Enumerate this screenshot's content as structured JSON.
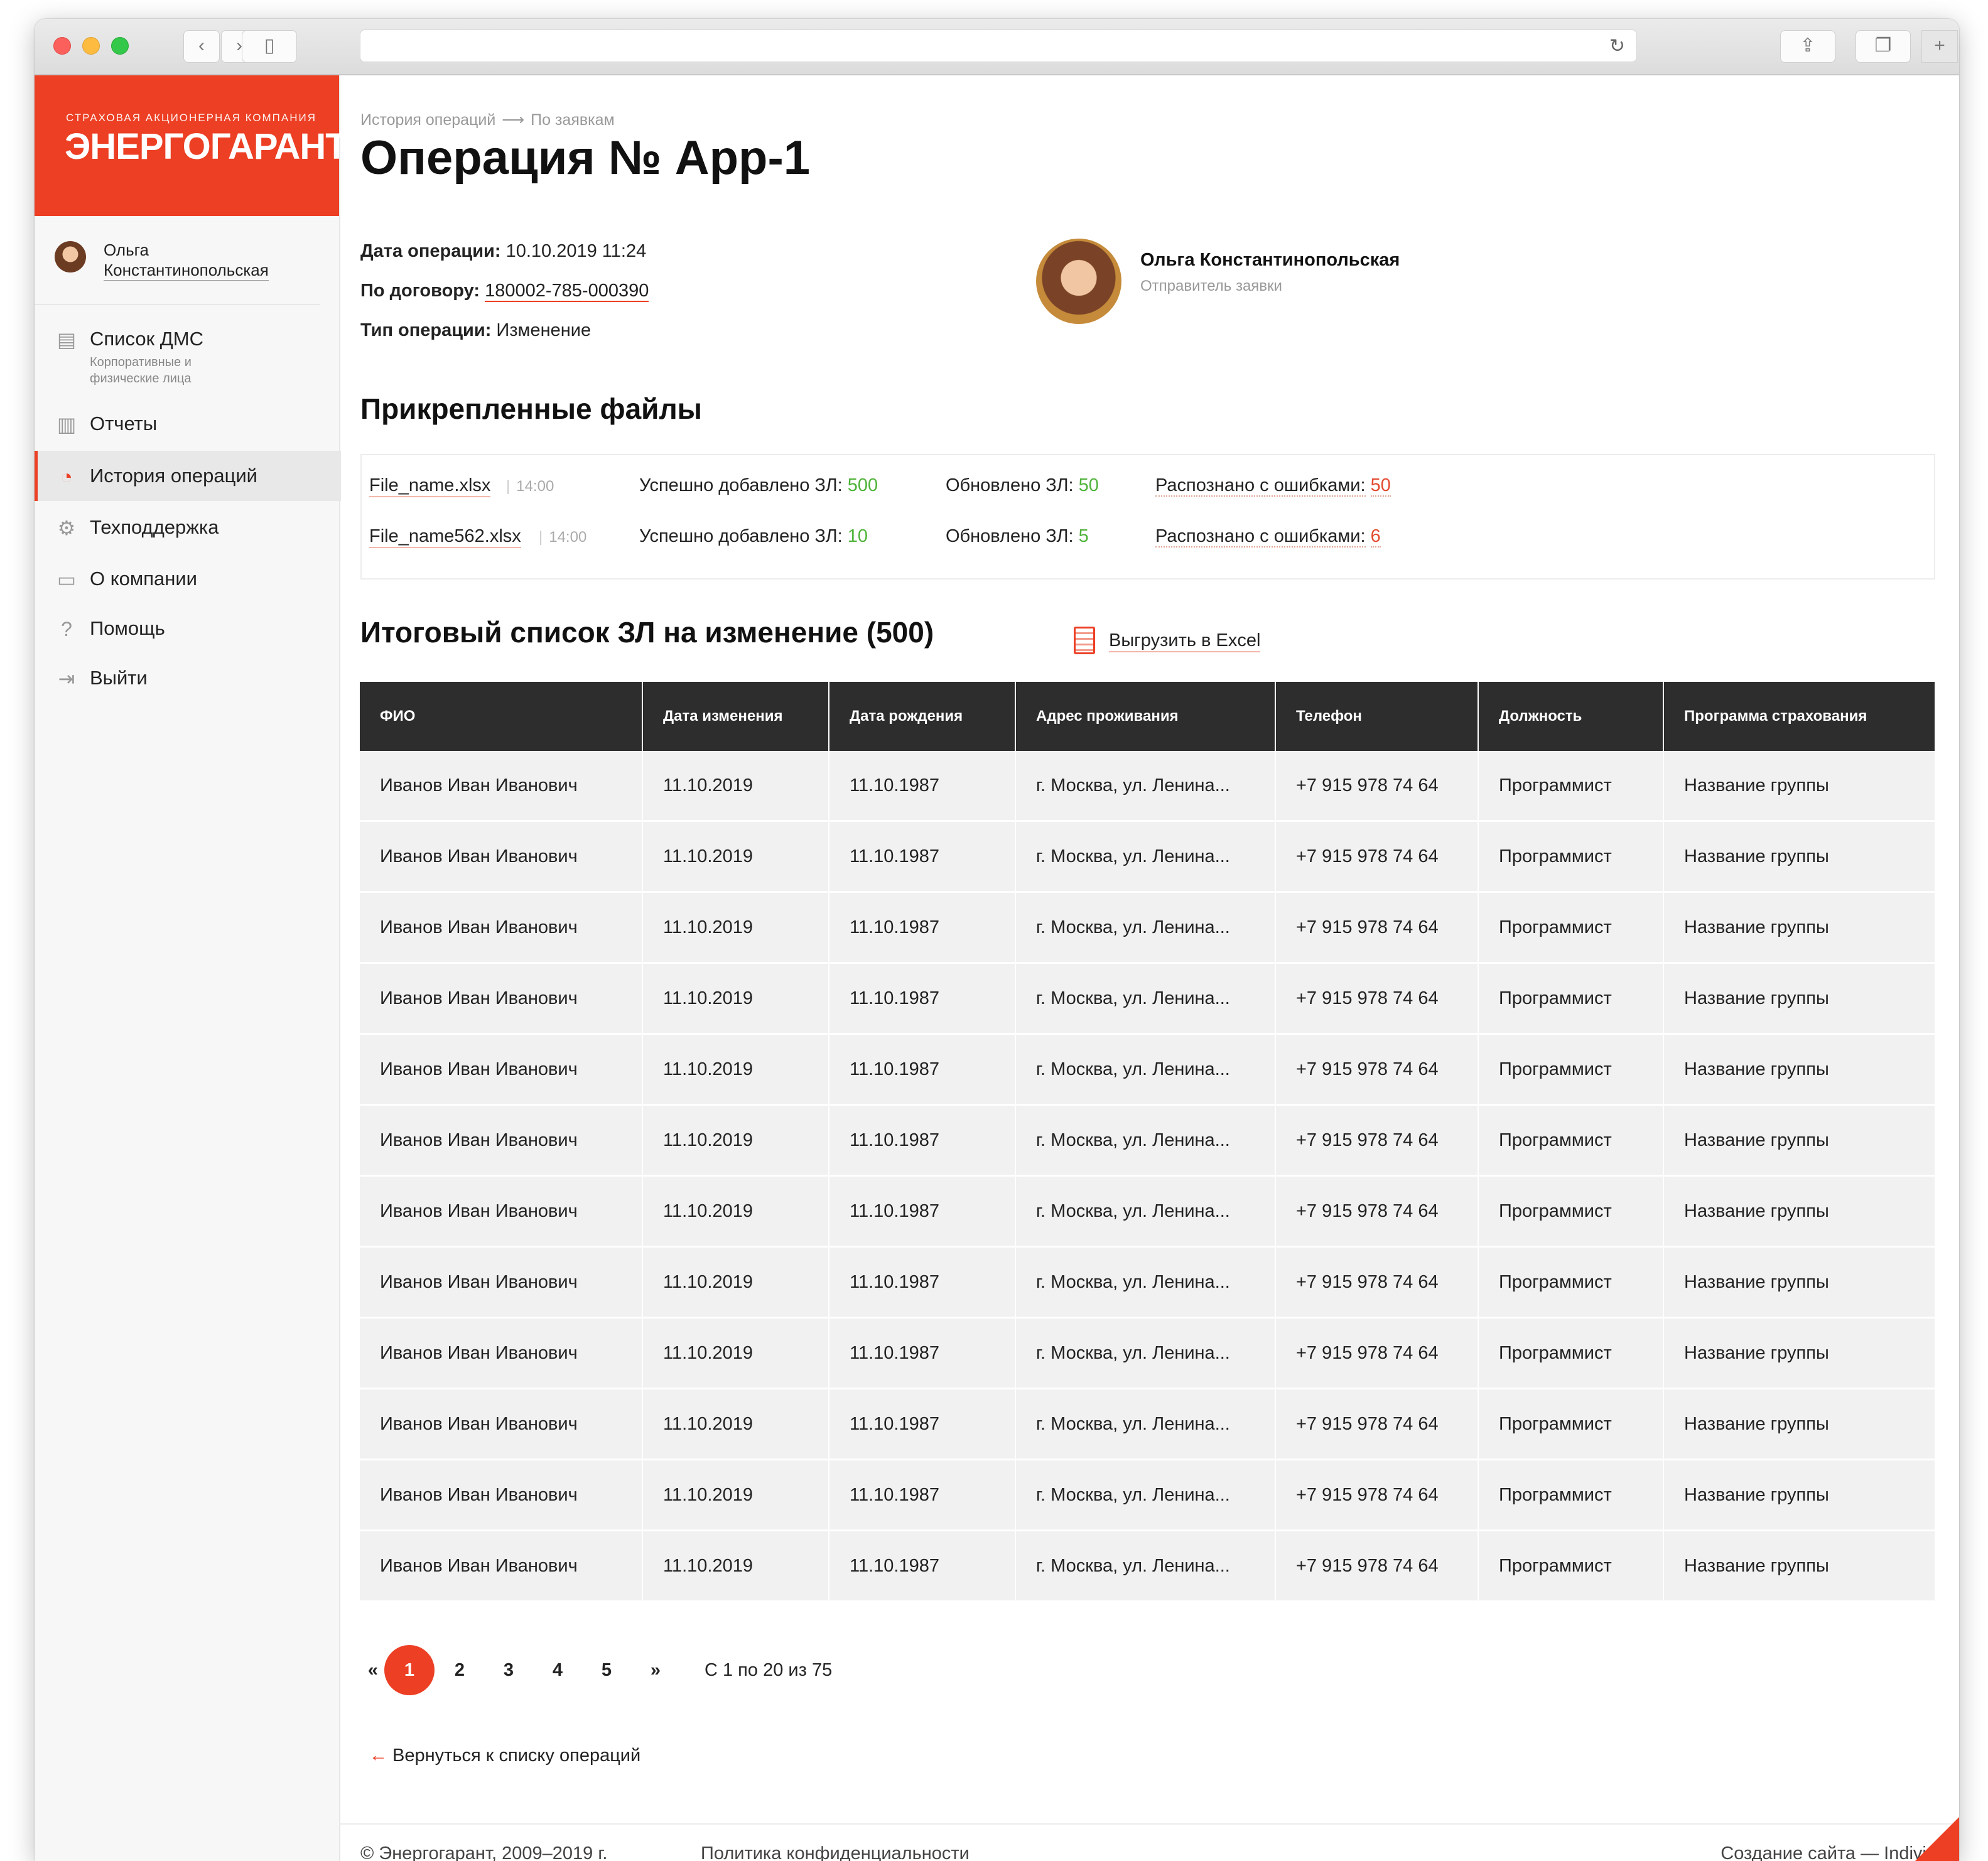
{
  "sidebar": {
    "brand_small": "Страховая акционерная компания",
    "brand_name": "ЭНЕРГОГАРАНТ",
    "user_name_line1": "Ольга",
    "user_name_line2": "Константинопольская",
    "items": [
      {
        "label": "Список ДМС",
        "sub": "Корпоративные и физические лица",
        "icon": "clipboard-icon"
      },
      {
        "label": "Отчеты",
        "icon": "bar-chart-icon"
      },
      {
        "label": "История операций",
        "icon": "clock-icon",
        "active": true
      },
      {
        "label": "Техподдержка",
        "icon": "gear-icon"
      },
      {
        "label": "О компании",
        "icon": "briefcase-icon"
      },
      {
        "label": "Помощь",
        "icon": "help-icon"
      },
      {
        "label": "Выйти",
        "icon": "logout-icon"
      }
    ]
  },
  "breadcrumb": {
    "item1": "История операций",
    "item2": "По заявкам"
  },
  "page_title": "Операция № App-1",
  "meta": {
    "date_label": "Дата операции:",
    "date_value": "10.10.2019 11:24",
    "contract_label": "По договору:",
    "contract_value": "180002-785-000390",
    "type_label": "Тип операции:",
    "type_value": "Изменение"
  },
  "sender": {
    "name": "Ольга Константинопольская",
    "role": "Отправитель заявки"
  },
  "files_title": "Прикрепленные файлы",
  "files": [
    {
      "name": "File_name.xlsx",
      "time": "14:00",
      "added_label": "Успешно добавлено ЗЛ:",
      "added": "500",
      "updated_label": "Обновлено ЗЛ:",
      "updated": "50",
      "errors_label": "Распознано с ошибками:",
      "errors": "50"
    },
    {
      "name": "File_name562.xlsx",
      "time": "14:00",
      "added_label": "Успешно добавлено ЗЛ:",
      "added": "10",
      "updated_label": "Обновлено ЗЛ:",
      "updated": "5",
      "errors_label": "Распознано с ошибками:",
      "errors": "6"
    }
  ],
  "list_title": "Итоговый список ЗЛ на изменение (500)",
  "export_label": "Выгрузить в Excel",
  "table": {
    "columns": [
      "ФИО",
      "Дата изменения",
      "Дата рождения",
      "Адрес проживания",
      "Телефон",
      "Должность",
      "Программа страхования"
    ],
    "rows": [
      [
        "Иванов Иван Иванович",
        "11.10.2019",
        "11.10.1987",
        "г. Москва, ул. Ленина...",
        "+7 915 978 74 64",
        "Программист",
        "Название группы"
      ],
      [
        "Иванов Иван Иванович",
        "11.10.2019",
        "11.10.1987",
        "г. Москва, ул. Ленина...",
        "+7 915 978 74 64",
        "Программист",
        "Название группы"
      ],
      [
        "Иванов Иван Иванович",
        "11.10.2019",
        "11.10.1987",
        "г. Москва, ул. Ленина...",
        "+7 915 978 74 64",
        "Программист",
        "Название группы"
      ],
      [
        "Иванов Иван Иванович",
        "11.10.2019",
        "11.10.1987",
        "г. Москва, ул. Ленина...",
        "+7 915 978 74 64",
        "Программист",
        "Название группы"
      ],
      [
        "Иванов Иван Иванович",
        "11.10.2019",
        "11.10.1987",
        "г. Москва, ул. Ленина...",
        "+7 915 978 74 64",
        "Программист",
        "Название группы"
      ],
      [
        "Иванов Иван Иванович",
        "11.10.2019",
        "11.10.1987",
        "г. Москва, ул. Ленина...",
        "+7 915 978 74 64",
        "Программист",
        "Название группы"
      ],
      [
        "Иванов Иван Иванович",
        "11.10.2019",
        "11.10.1987",
        "г. Москва, ул. Ленина...",
        "+7 915 978 74 64",
        "Программист",
        "Название группы"
      ],
      [
        "Иванов Иван Иванович",
        "11.10.2019",
        "11.10.1987",
        "г. Москва, ул. Ленина...",
        "+7 915 978 74 64",
        "Программист",
        "Название группы"
      ],
      [
        "Иванов Иван Иванович",
        "11.10.2019",
        "11.10.1987",
        "г. Москва, ул. Ленина...",
        "+7 915 978 74 64",
        "Программист",
        "Название группы"
      ],
      [
        "Иванов Иван Иванович",
        "11.10.2019",
        "11.10.1987",
        "г. Москва, ул. Ленина...",
        "+7 915 978 74 64",
        "Программист",
        "Название группы"
      ],
      [
        "Иванов Иван Иванович",
        "11.10.2019",
        "11.10.1987",
        "г. Москва, ул. Ленина...",
        "+7 915 978 74 64",
        "Программист",
        "Название группы"
      ],
      [
        "Иванов Иван Иванович",
        "11.10.2019",
        "11.10.1987",
        "г. Москва, ул. Ленина...",
        "+7 915 978 74 64",
        "Программист",
        "Название группы"
      ]
    ]
  },
  "pagination": {
    "prev": "«",
    "pages": [
      "1",
      "2",
      "3",
      "4",
      "5"
    ],
    "current": "1",
    "next": "»",
    "info": "С 1 по 20 из 75"
  },
  "back_link": "Вернуться к списку операций",
  "footer": {
    "copyright": "© Энергогарант, 2009–2019 г.",
    "privacy": "Политика конфиденциальности",
    "credit": "Создание сайта — Individ"
  },
  "colors": {
    "accent": "#ec3f24",
    "success": "#4fb33a",
    "header_bg": "#2d2d2d"
  }
}
